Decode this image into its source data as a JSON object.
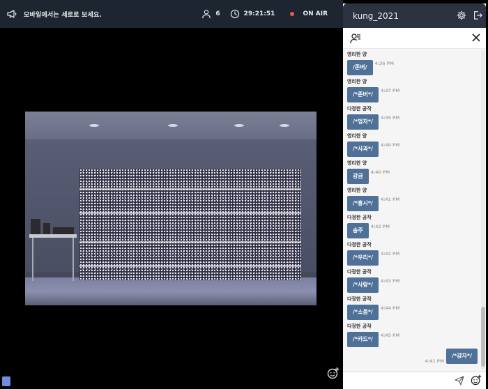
{
  "topbar": {
    "notice": "모바일에서는 세로로 보세요.",
    "viewers": "6",
    "time": "29:21:51",
    "status": "ON AIR",
    "status_color": "#ea5b4d"
  },
  "panel": {
    "username": "kung_2021",
    "input_placeholder": ""
  },
  "messages": [
    {
      "sender": "영리한 양",
      "text": "/존버/",
      "time": "4:36 PM"
    },
    {
      "sender": "영리한 양",
      "text": "/*존버*/",
      "time": "4:37 PM"
    },
    {
      "sender": "다정한 공작",
      "text": "/*멍차*/",
      "time": "4:39 PM"
    },
    {
      "sender": "영리한 양",
      "text": "/*사과*/",
      "time": "4:40 PM"
    },
    {
      "sender": "영리한 양",
      "text": "강금",
      "time": "4:40 PM"
    },
    {
      "sender": "영리한 양",
      "text": "/*홍시*/",
      "time": "4:41 PM"
    },
    {
      "sender": "다정한 공작",
      "text": "송주",
      "time": "4:42 PM"
    },
    {
      "sender": "다정한 공작",
      "text": "/*우리*/",
      "time": "4:42 PM"
    },
    {
      "sender": "다정한 공작",
      "text": "/*사랑*/",
      "time": "4:43 PM"
    },
    {
      "sender": "다정한 공작",
      "text": "/*소음*/",
      "time": "4:44 PM"
    },
    {
      "sender": "다정한 공작",
      "text": "/*카드*/",
      "time": "4:45 PM"
    }
  ],
  "my_message": {
    "text": "/*감자*/",
    "time": "4:41 PM"
  },
  "icons": {
    "notice": "megaphone-icon",
    "viewers": "user-icon",
    "time": "clock-icon",
    "settings": "gear-icon",
    "logout": "logout-icon",
    "participants": "user-list-icon",
    "close": "close-icon",
    "send": "send-icon",
    "emoji": "emoji-add-icon"
  }
}
